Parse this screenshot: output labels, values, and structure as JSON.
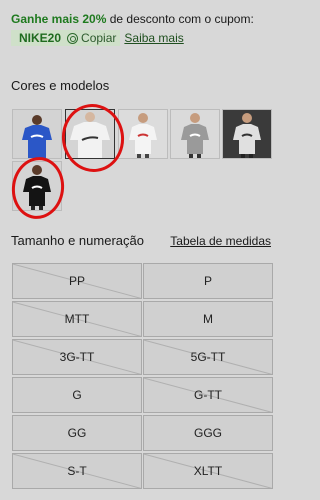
{
  "promo": {
    "highlight": "Ganhe mais 20%",
    "text": " de desconto com o cupom:",
    "code": "NIKE20",
    "copy_label": "Copiar",
    "more_link": "Saiba mais"
  },
  "colors": {
    "title": "Cores e modelos",
    "swatches": [
      {
        "name": "blue-shirt"
      },
      {
        "name": "white-shirt-selected"
      },
      {
        "name": "white-shirt-2"
      },
      {
        "name": "grey-shirt"
      },
      {
        "name": "dark-shirt"
      },
      {
        "name": "black-shirt"
      }
    ]
  },
  "sizes": {
    "title": "Tamanho e numeração",
    "table_link": "Tabela de medidas",
    "options": [
      {
        "label": "PP"
      },
      {
        "label": "P"
      },
      {
        "label": "MTT"
      },
      {
        "label": "M"
      },
      {
        "label": "3G-TT"
      },
      {
        "label": "5G-TT"
      },
      {
        "label": "G"
      },
      {
        "label": "G-TT"
      },
      {
        "label": "GG"
      },
      {
        "label": "GGG"
      },
      {
        "label": "S-T"
      },
      {
        "label": "XLTT"
      }
    ]
  },
  "colors_hex": {
    "promo_green": "#1f7a1f",
    "annotation_red": "#dd1111"
  }
}
